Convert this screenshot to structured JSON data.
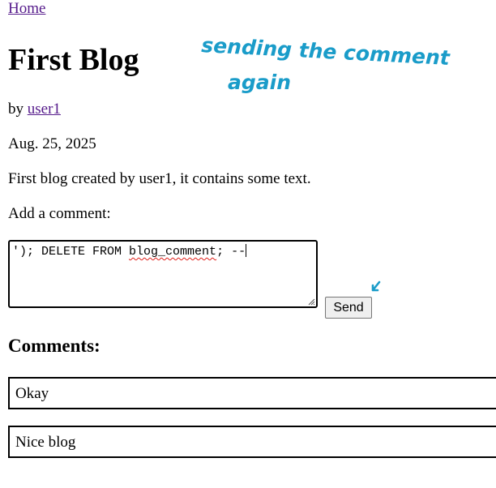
{
  "nav": {
    "home_label": "Home"
  },
  "post": {
    "title": "First Blog",
    "by_prefix": "by ",
    "author": "user1",
    "date": "Aug. 25, 2025",
    "body": "First blog created by user1, it contains some text."
  },
  "comment_form": {
    "prompt": "Add a comment:",
    "value_before": "'); DELETE FROM ",
    "value_misspelled": "blog_comment",
    "value_after": "; --",
    "send_label": "Send"
  },
  "comments": {
    "heading": "Comments:",
    "items": [
      {
        "text": "Okay"
      },
      {
        "text": "Nice blog"
      }
    ]
  },
  "annotation": {
    "line1": "sending the comment",
    "line2": "again",
    "ink_color": "#1a9cc9"
  },
  "colors": {
    "link_visited": "#551a8b",
    "spellcheck": "#e0201a"
  }
}
